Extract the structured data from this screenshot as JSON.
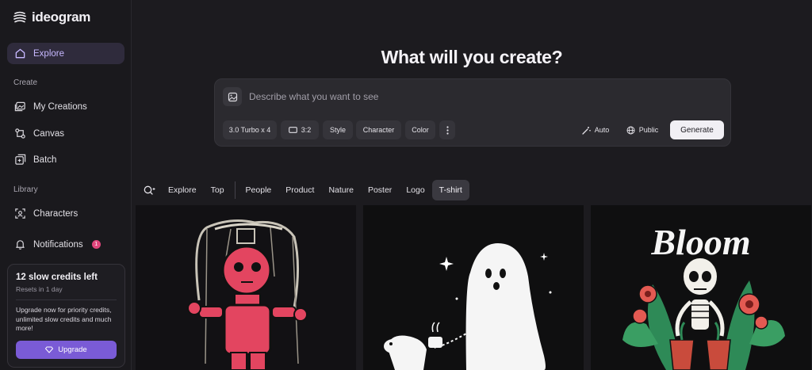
{
  "brand": {
    "name": "ideogram"
  },
  "sidebar": {
    "explore": "Explore",
    "create_label": "Create",
    "my_creations": "My Creations",
    "canvas": "Canvas",
    "batch": "Batch",
    "library_label": "Library",
    "characters": "Characters",
    "notifications": "Notifications",
    "notifications_count": "1"
  },
  "credits": {
    "title": "12 slow credits left",
    "reset": "Resets in 1 day",
    "message": "Upgrade now for priority credits, unlimited slow credits and much more!",
    "upgrade": "Upgrade"
  },
  "hero": {
    "title": "What will you create?"
  },
  "prompt": {
    "placeholder": "Describe what you want to see",
    "model": "3.0 Turbo x 4",
    "aspect": "3:2",
    "style": "Style",
    "character": "Character",
    "color": "Color",
    "auto": "Auto",
    "visibility": "Public",
    "generate": "Generate"
  },
  "filters": {
    "tabs": [
      "Explore",
      "Top",
      "People",
      "Product",
      "Nature",
      "Poster",
      "Logo",
      "T-shirt"
    ],
    "active": "T-shirt"
  },
  "gallery": {
    "card3_text": "Bloom"
  },
  "colors": {
    "accent": "#7a5bd6",
    "active_nav_bg": "#2f2b3c",
    "badge": "#e0457b"
  }
}
